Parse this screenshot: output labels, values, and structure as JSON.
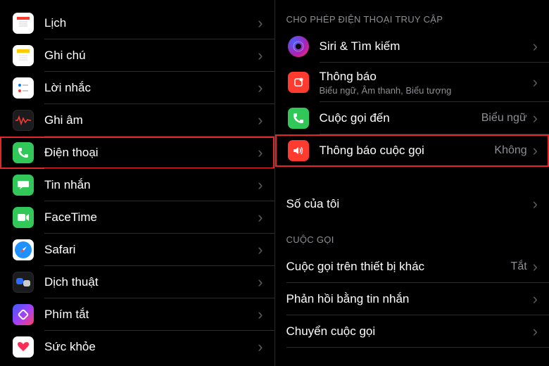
{
  "left": {
    "items": [
      {
        "label": "Lịch",
        "icon": "calendar"
      },
      {
        "label": "Ghi chú",
        "icon": "notes"
      },
      {
        "label": "Lời nhắc",
        "icon": "reminders"
      },
      {
        "label": "Ghi âm",
        "icon": "voicememos"
      },
      {
        "label": "Điện thoại",
        "icon": "phone",
        "highlight": true
      },
      {
        "label": "Tin nhắn",
        "icon": "messages"
      },
      {
        "label": "FaceTime",
        "icon": "facetime"
      },
      {
        "label": "Safari",
        "icon": "safari"
      },
      {
        "label": "Dịch thuật",
        "icon": "translate"
      },
      {
        "label": "Phím tắt",
        "icon": "shortcuts"
      },
      {
        "label": "Sức khỏe",
        "icon": "health"
      }
    ]
  },
  "right": {
    "section_access": "CHO PHÉP ĐIỆN THOẠI TRUY CẬP",
    "access": [
      {
        "label": "Siri & Tìm kiếm",
        "icon": "siri"
      },
      {
        "label": "Thông báo",
        "sub": "Biểu ngữ, Âm thanh, Biểu tượng",
        "icon": "notif"
      },
      {
        "label": "Cuộc gọi đến",
        "value": "Biểu ngữ",
        "icon": "incoming"
      },
      {
        "label": "Thông báo cuộc gọi",
        "value": "Không",
        "icon": "announce",
        "highlight": true
      }
    ],
    "my_number": "Số của tôi",
    "section_calls": "CUỘC GỌI",
    "calls": [
      {
        "label": "Cuộc gọi trên thiết bị khác",
        "value": "Tắt"
      },
      {
        "label": "Phản hồi bằng tin nhắn"
      },
      {
        "label": "Chuyển cuộc gọi"
      }
    ]
  }
}
